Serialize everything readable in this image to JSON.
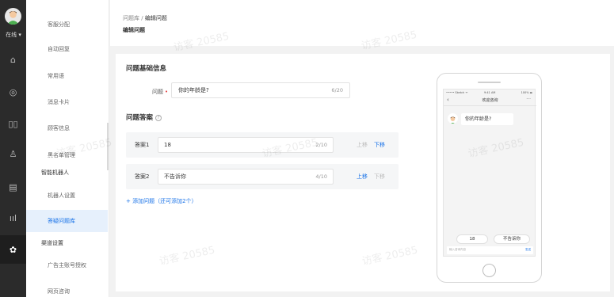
{
  "rail": {
    "status": "在线",
    "status_caret": "▾",
    "icons": [
      {
        "name": "home-icon",
        "glyph": "⌂"
      },
      {
        "name": "chat-icon",
        "glyph": "◎"
      },
      {
        "name": "grid-icon",
        "glyph": "▯▯"
      },
      {
        "name": "user-icon",
        "glyph": "♙"
      },
      {
        "name": "document-icon",
        "glyph": "▤"
      },
      {
        "name": "chart-icon",
        "glyph": "ııl"
      },
      {
        "name": "gear-icon",
        "glyph": "✿"
      }
    ]
  },
  "menu": {
    "items": [
      {
        "label": "客服分配",
        "type": "item"
      },
      {
        "label": "自动回复",
        "type": "item"
      },
      {
        "label": "常用语",
        "type": "item"
      },
      {
        "label": "消息卡片",
        "type": "item"
      },
      {
        "label": "顾客信息",
        "type": "item"
      },
      {
        "label": "黑名单管理",
        "type": "item"
      },
      {
        "label": "智能机器人",
        "type": "group"
      },
      {
        "label": "机器人设置",
        "type": "item"
      },
      {
        "label": "答疑问题库",
        "type": "item",
        "active": true
      },
      {
        "label": "渠道设置",
        "type": "group"
      },
      {
        "label": "广告主账号授权",
        "type": "item"
      },
      {
        "label": "网页咨询",
        "type": "item"
      }
    ]
  },
  "header": {
    "breadcrumb_root": "问题库",
    "breadcrumb_sep": "/",
    "breadcrumb_current": "编辑问题",
    "title": "编辑问题"
  },
  "form": {
    "basic_title": "问题基础信息",
    "question_label": "问题",
    "question_required": "•",
    "question_value": "你的年龄是?",
    "question_count": "6/20",
    "answers_title": "问题答案",
    "help_glyph": "?",
    "answers": [
      {
        "label": "答案1",
        "value": "18",
        "count": "2/10",
        "up": "上移",
        "down": "下移",
        "up_enabled": false,
        "down_enabled": true
      },
      {
        "label": "答案2",
        "value": "不告诉你",
        "count": "4/10",
        "up": "上移",
        "down": "下移",
        "up_enabled": true,
        "down_enabled": false
      }
    ],
    "add_question": "+ 添加问题（还可添加2个）"
  },
  "preview": {
    "carrier": "••••• Sketch ᯤ",
    "time": "9:41 AM",
    "battery": "100% ▬",
    "back": "‹",
    "title": "欢迎咨询",
    "more": "···",
    "bubble": "你的年龄是?",
    "chips": [
      "18",
      "不告诉你"
    ],
    "input_placeholder": "输入咨询内容",
    "send": "发送"
  },
  "watermark": "访客 20585",
  "colors": {
    "accent": "#1a73e8",
    "rail": "#2b2b2b",
    "required": "#e54545"
  }
}
